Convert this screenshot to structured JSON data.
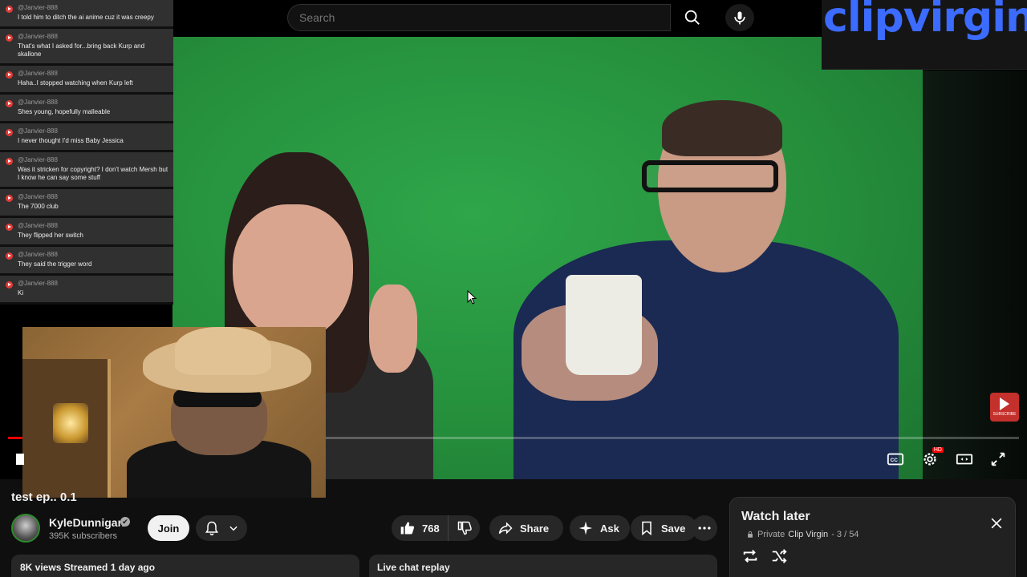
{
  "search": {
    "placeholder": "Search"
  },
  "logo": {
    "text": "clipvirgin"
  },
  "chat": {
    "items": [
      {
        "user": "@Janvier-888",
        "message": "I told him to ditch the ai anime cuz it was creepy"
      },
      {
        "user": "@Janvier-888",
        "message": "That's what I asked for...bring back Kurp and skallone"
      },
      {
        "user": "@Janvier-888",
        "message": "Haha..I stopped watching when Kurp left"
      },
      {
        "user": "@Janvier-888",
        "message": "Shes young, hopefully malleable"
      },
      {
        "user": "@Janvier-888",
        "message": "I never thought I'd miss Baby Jessica"
      },
      {
        "user": "@Janvier-888",
        "message": "Was it stricken for copyright? I don't watch Mersh but I know he can say some stuff"
      },
      {
        "user": "@Janvier-888",
        "message": "The 7000 club"
      },
      {
        "user": "@Janvier-888",
        "message": "They flipped her switch"
      },
      {
        "user": "@Janvier-888",
        "message": "They said the trigger word"
      },
      {
        "user": "@Janvier-888",
        "message": "Ki"
      }
    ]
  },
  "player": {
    "progress_fraction": 0.014,
    "subscribe_label": "SUBSCRIBE",
    "hd_badge": "HD",
    "icons": [
      "cc-icon",
      "settings-icon",
      "theater-icon",
      "fullscreen-icon"
    ]
  },
  "video": {
    "title": "test ep.. 0.1",
    "channel_name": "KyleDunnigan",
    "verified_mark": "✔",
    "subscribers": "395K subscribers",
    "join_label": "Join",
    "likes": "768",
    "share_label": "Share",
    "ask_label": "Ask",
    "save_label": "Save",
    "views_streamed": "8K views  Streamed 1 day ago",
    "live_chat_replay": "Live chat replay"
  },
  "watch_later": {
    "title": "Watch later",
    "privacy": "Private",
    "owner": "Clip Virgin",
    "position": "- 3 / 54"
  },
  "colors": {
    "accent_red": "#ff0000",
    "logo_blue": "#3c6bff",
    "background": "#0f0f0f"
  }
}
